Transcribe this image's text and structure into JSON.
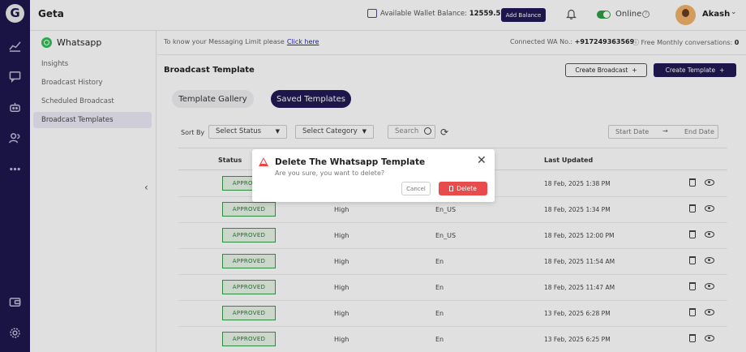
{
  "app": {
    "brand": "Geta",
    "logo_letter": "G"
  },
  "header": {
    "wallet_label": "Available Wallet Balance:",
    "wallet_value": "12559.59",
    "add_balance": "Add Balance",
    "status": "Online",
    "user_name": "Akash"
  },
  "sidebar": {
    "section": "Whatsapp",
    "items": [
      {
        "label": "Insights"
      },
      {
        "label": "Broadcast History"
      },
      {
        "label": "Scheduled Broadcast"
      },
      {
        "label": "Broadcast Templates"
      }
    ],
    "active_item": "Broadcast Templates"
  },
  "infobar": {
    "limit_text": "To know your Messaging Limit please",
    "limit_link": "Click here",
    "connected_label": "Connected WA No.:",
    "connected_value": "+917249363569",
    "free_label": "Free Monthly conversations:",
    "free_value": "0"
  },
  "page": {
    "title": "Broadcast Template",
    "create_broadcast": "Create Broadcast",
    "create_template": "Create Template",
    "tabs": [
      {
        "label": "Template Gallery"
      },
      {
        "label": "Saved Templates"
      }
    ],
    "active_tab": "Saved Templates"
  },
  "filters": {
    "sort_by": "Sort By",
    "status_select": "Select Status",
    "category_select": "Select Category",
    "search_placeholder": "Search",
    "start_date": "Start Date",
    "end_date": "End Date"
  },
  "table": {
    "columns": {
      "status": "Status",
      "last_updated": "Last Updated"
    },
    "rows": [
      {
        "status": "APPROVED",
        "category": "",
        "language": "",
        "updated": "18 Feb, 2025 1:38 PM"
      },
      {
        "status": "APPROVED",
        "category": "High",
        "language": "En_US",
        "updated": "18 Feb, 2025 1:34 PM"
      },
      {
        "status": "APPROVED",
        "category": "High",
        "language": "En_US",
        "updated": "18 Feb, 2025 12:00 PM"
      },
      {
        "status": "APPROVED",
        "category": "High",
        "language": "En",
        "updated": "18 Feb, 2025 11:54 AM"
      },
      {
        "status": "APPROVED",
        "category": "High",
        "language": "En",
        "updated": "18 Feb, 2025 11:47 AM"
      },
      {
        "status": "APPROVED",
        "category": "High",
        "language": "En",
        "updated": "13 Feb, 2025 6:28 PM"
      },
      {
        "status": "APPROVED",
        "category": "High",
        "language": "En",
        "updated": "13 Feb, 2025 6:25 PM"
      }
    ]
  },
  "modal": {
    "title": "Delete The Whatsapp Template",
    "message": "Are you sure, you want to delete?",
    "cancel": "Cancel",
    "delete": "Delete"
  },
  "colors": {
    "primary": "#211a56",
    "approved_border": "#3a9a4a",
    "danger": "#e84b4b",
    "online": "#2e9e45"
  }
}
